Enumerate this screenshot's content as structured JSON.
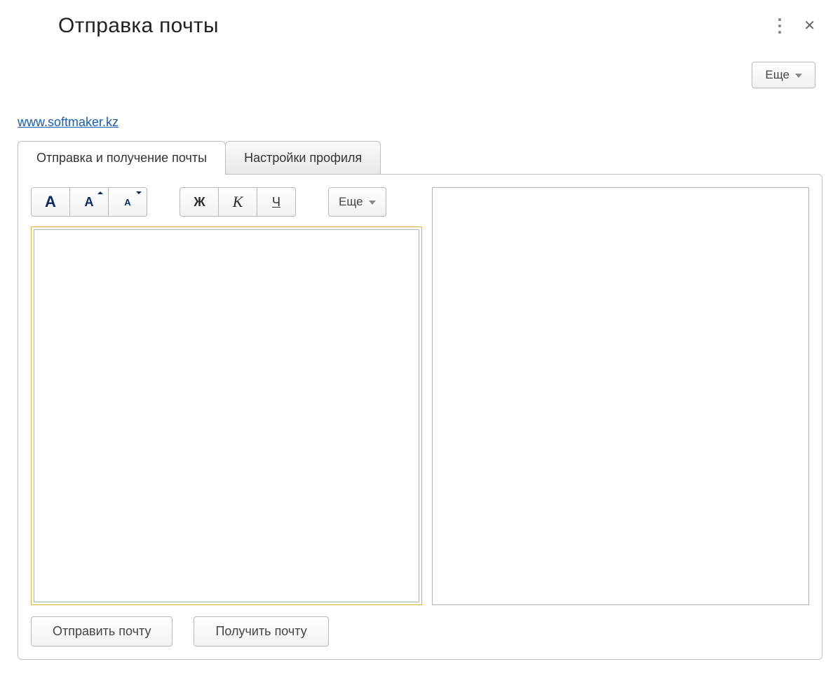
{
  "window": {
    "title": "Отправка почты"
  },
  "header": {
    "more_label": "Еще"
  },
  "link": {
    "site": "www.softmaker.kz"
  },
  "tabs": {
    "0": {
      "label": "Отправка и получение почты"
    },
    "1": {
      "label": "Настройки профиля"
    }
  },
  "toolbar": {
    "font_big_icon": "А",
    "font_mid_icon": "А",
    "font_sml_icon": "А",
    "bold_icon": "Ж",
    "italic_icon": "К",
    "underline_icon": "Ч",
    "more_label": "Еще"
  },
  "editor": {
    "content": ""
  },
  "preview": {
    "content": ""
  },
  "buttons": {
    "send": "Отправить почту",
    "receive": "Получить почту"
  }
}
